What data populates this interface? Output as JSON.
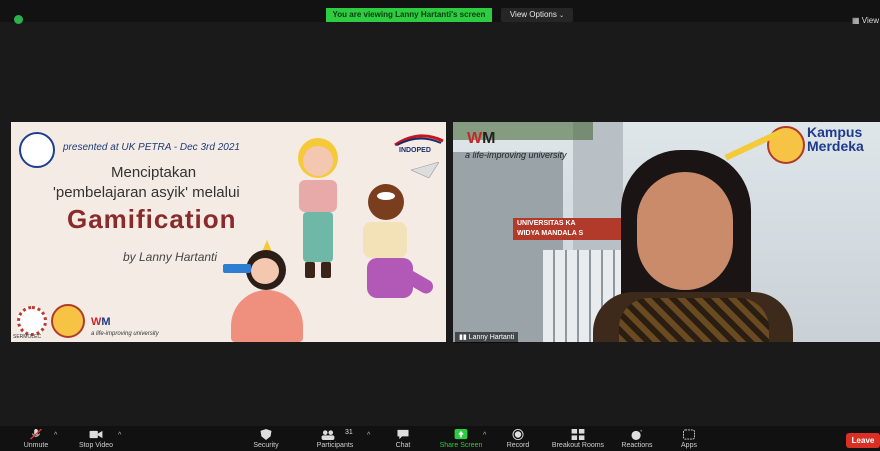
{
  "header": {
    "banner_text": "You are viewing Lanny Hartanti's screen",
    "view_options_label": "View Options",
    "view_right_label": "View",
    "shield_icon": "shield-check-icon"
  },
  "slide": {
    "presented": "presented at UK PETRA - Dec 3rd 2021",
    "line1": "Menciptakan",
    "line2": "'pembelajaran asyik' melalui",
    "title": "Gamification",
    "byline": "by Lanny Hartanti",
    "indoped": "INDOPED",
    "sermolec": "SERMOLEC",
    "tagline": "a life-improving university"
  },
  "camera": {
    "tagline": "a life-improving university",
    "kampus_line1": "Kampus",
    "kampus_line2": "Merdeka",
    "participant_name": "Lanny Hartanti"
  },
  "toolbar": {
    "unmute": "Unmute",
    "stop_video": "Stop Video",
    "security": "Security",
    "participants": "Participants",
    "participants_count": "31",
    "chat": "Chat",
    "share_screen": "Share Screen",
    "record": "Record",
    "breakout": "Breakout Rooms",
    "reactions": "Reactions",
    "apps": "Apps",
    "leave": "Leave"
  },
  "colors": {
    "banner_green": "#2ecc40",
    "share_green": "#2ecc40",
    "leave_red": "#d93025",
    "title_maroon": "#8a2a2a"
  }
}
